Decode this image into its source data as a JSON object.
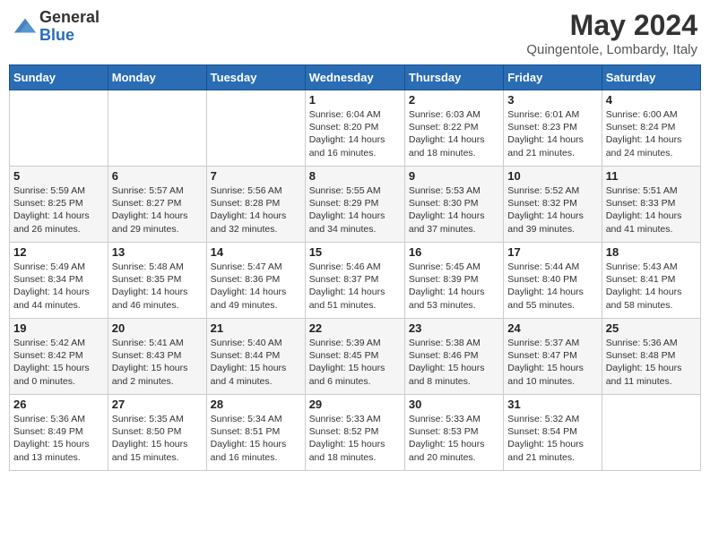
{
  "header": {
    "logo_general": "General",
    "logo_blue": "Blue",
    "month_year": "May 2024",
    "location": "Quingentole, Lombardy, Italy"
  },
  "weekdays": [
    "Sunday",
    "Monday",
    "Tuesday",
    "Wednesday",
    "Thursday",
    "Friday",
    "Saturday"
  ],
  "weeks": [
    [
      {
        "day": "",
        "detail": ""
      },
      {
        "day": "",
        "detail": ""
      },
      {
        "day": "",
        "detail": ""
      },
      {
        "day": "1",
        "detail": "Sunrise: 6:04 AM\nSunset: 8:20 PM\nDaylight: 14 hours and 16 minutes."
      },
      {
        "day": "2",
        "detail": "Sunrise: 6:03 AM\nSunset: 8:22 PM\nDaylight: 14 hours and 18 minutes."
      },
      {
        "day": "3",
        "detail": "Sunrise: 6:01 AM\nSunset: 8:23 PM\nDaylight: 14 hours and 21 minutes."
      },
      {
        "day": "4",
        "detail": "Sunrise: 6:00 AM\nSunset: 8:24 PM\nDaylight: 14 hours and 24 minutes."
      }
    ],
    [
      {
        "day": "5",
        "detail": "Sunrise: 5:59 AM\nSunset: 8:25 PM\nDaylight: 14 hours and 26 minutes."
      },
      {
        "day": "6",
        "detail": "Sunrise: 5:57 AM\nSunset: 8:27 PM\nDaylight: 14 hours and 29 minutes."
      },
      {
        "day": "7",
        "detail": "Sunrise: 5:56 AM\nSunset: 8:28 PM\nDaylight: 14 hours and 32 minutes."
      },
      {
        "day": "8",
        "detail": "Sunrise: 5:55 AM\nSunset: 8:29 PM\nDaylight: 14 hours and 34 minutes."
      },
      {
        "day": "9",
        "detail": "Sunrise: 5:53 AM\nSunset: 8:30 PM\nDaylight: 14 hours and 37 minutes."
      },
      {
        "day": "10",
        "detail": "Sunrise: 5:52 AM\nSunset: 8:32 PM\nDaylight: 14 hours and 39 minutes."
      },
      {
        "day": "11",
        "detail": "Sunrise: 5:51 AM\nSunset: 8:33 PM\nDaylight: 14 hours and 41 minutes."
      }
    ],
    [
      {
        "day": "12",
        "detail": "Sunrise: 5:49 AM\nSunset: 8:34 PM\nDaylight: 14 hours and 44 minutes."
      },
      {
        "day": "13",
        "detail": "Sunrise: 5:48 AM\nSunset: 8:35 PM\nDaylight: 14 hours and 46 minutes."
      },
      {
        "day": "14",
        "detail": "Sunrise: 5:47 AM\nSunset: 8:36 PM\nDaylight: 14 hours and 49 minutes."
      },
      {
        "day": "15",
        "detail": "Sunrise: 5:46 AM\nSunset: 8:37 PM\nDaylight: 14 hours and 51 minutes."
      },
      {
        "day": "16",
        "detail": "Sunrise: 5:45 AM\nSunset: 8:39 PM\nDaylight: 14 hours and 53 minutes."
      },
      {
        "day": "17",
        "detail": "Sunrise: 5:44 AM\nSunset: 8:40 PM\nDaylight: 14 hours and 55 minutes."
      },
      {
        "day": "18",
        "detail": "Sunrise: 5:43 AM\nSunset: 8:41 PM\nDaylight: 14 hours and 58 minutes."
      }
    ],
    [
      {
        "day": "19",
        "detail": "Sunrise: 5:42 AM\nSunset: 8:42 PM\nDaylight: 15 hours and 0 minutes."
      },
      {
        "day": "20",
        "detail": "Sunrise: 5:41 AM\nSunset: 8:43 PM\nDaylight: 15 hours and 2 minutes."
      },
      {
        "day": "21",
        "detail": "Sunrise: 5:40 AM\nSunset: 8:44 PM\nDaylight: 15 hours and 4 minutes."
      },
      {
        "day": "22",
        "detail": "Sunrise: 5:39 AM\nSunset: 8:45 PM\nDaylight: 15 hours and 6 minutes."
      },
      {
        "day": "23",
        "detail": "Sunrise: 5:38 AM\nSunset: 8:46 PM\nDaylight: 15 hours and 8 minutes."
      },
      {
        "day": "24",
        "detail": "Sunrise: 5:37 AM\nSunset: 8:47 PM\nDaylight: 15 hours and 10 minutes."
      },
      {
        "day": "25",
        "detail": "Sunrise: 5:36 AM\nSunset: 8:48 PM\nDaylight: 15 hours and 11 minutes."
      }
    ],
    [
      {
        "day": "26",
        "detail": "Sunrise: 5:36 AM\nSunset: 8:49 PM\nDaylight: 15 hours and 13 minutes."
      },
      {
        "day": "27",
        "detail": "Sunrise: 5:35 AM\nSunset: 8:50 PM\nDaylight: 15 hours and 15 minutes."
      },
      {
        "day": "28",
        "detail": "Sunrise: 5:34 AM\nSunset: 8:51 PM\nDaylight: 15 hours and 16 minutes."
      },
      {
        "day": "29",
        "detail": "Sunrise: 5:33 AM\nSunset: 8:52 PM\nDaylight: 15 hours and 18 minutes."
      },
      {
        "day": "30",
        "detail": "Sunrise: 5:33 AM\nSunset: 8:53 PM\nDaylight: 15 hours and 20 minutes."
      },
      {
        "day": "31",
        "detail": "Sunrise: 5:32 AM\nSunset: 8:54 PM\nDaylight: 15 hours and 21 minutes."
      },
      {
        "day": "",
        "detail": ""
      }
    ]
  ]
}
